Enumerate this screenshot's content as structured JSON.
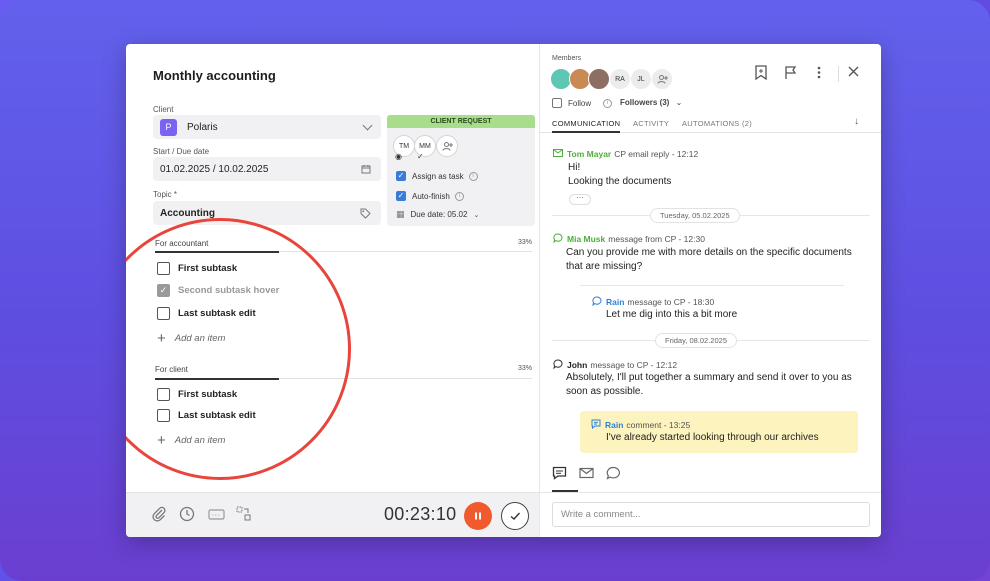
{
  "task": {
    "title": "Monthly accounting",
    "client_label": "Client",
    "client_initial": "P",
    "client_value": "Polaris",
    "dates_label": "Start / Due date",
    "dates_value": "01.02.2025 / 10.02.2025",
    "topic_label": "Topic *",
    "topic_value": "Accounting"
  },
  "client_request": {
    "header": "CLIENT REQUEST",
    "avatars": [
      "TM",
      "MM"
    ],
    "assign_label": "Assign as task",
    "autofinish_label": "Auto-finish",
    "due_label": "Due date: 05.02"
  },
  "checklists": [
    {
      "title": "For accountant",
      "percent": "33%",
      "progress": 0.33,
      "items": [
        {
          "label": "First subtask",
          "checked": false
        },
        {
          "label": "Second subtask hover",
          "checked": true
        },
        {
          "label": "Last subtask edit",
          "checked": false
        }
      ],
      "add_label": "Add an item"
    },
    {
      "title": "For client",
      "percent": "33%",
      "progress": 0.33,
      "items": [
        {
          "label": "First subtask",
          "checked": false
        },
        {
          "label": "Last subtask edit",
          "checked": false
        }
      ],
      "add_label": "Add an item"
    }
  ],
  "footer": {
    "timer": "00:23:10"
  },
  "right": {
    "members_label": "Members",
    "member_initials": [
      "RA",
      "JL"
    ],
    "follow_label": "Follow",
    "followers_label": "Followers (3)",
    "tabs": [
      "COMMUNICATION",
      "ACTIVITY",
      "AUTOMATIONS (2)"
    ],
    "messages": [
      {
        "author": "Tom Mayar",
        "meta": "CP email reply - 12:12",
        "body": "Hi!\nLooking the documents"
      },
      {
        "date": "Tuesday, 05.02.2025"
      },
      {
        "author": "Mia Musk",
        "meta": "message from CP - 12:30",
        "body": "Can you provide me with more details on the specific documents that are missing?"
      },
      {
        "author": "Rain",
        "meta": "message to CP - 18:30",
        "body": "Let me dig into this a bit more"
      },
      {
        "date": "Friday, 08.02.2025"
      },
      {
        "author": "John",
        "meta": "message to CP - 12:12",
        "body": "Absolutely, I'll put together a summary and send it over to you as soon as possible."
      },
      {
        "author": "Rain",
        "meta": "comment - 13:25",
        "body": "I've already started looking through our archives"
      }
    ],
    "comment_placeholder": "Write a comment..."
  }
}
